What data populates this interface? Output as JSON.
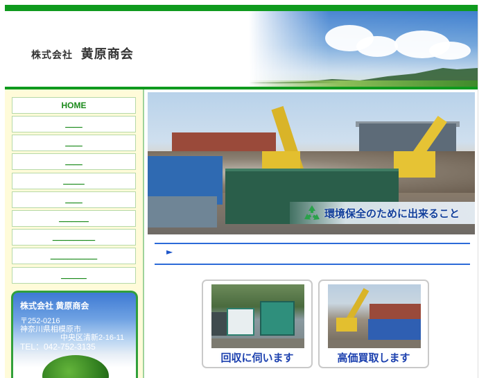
{
  "header": {
    "company_prefix": "株式会社",
    "company_name": "黄原商会"
  },
  "nav": {
    "items": [
      {
        "label": "HOME"
      },
      {
        "label": "____"
      },
      {
        "label": "____"
      },
      {
        "label": "____"
      },
      {
        "label": "_____"
      },
      {
        "label": "____"
      },
      {
        "label": "_______"
      },
      {
        "label": "__________"
      },
      {
        "label": "___________"
      },
      {
        "label": "______"
      }
    ]
  },
  "info": {
    "name": "株式会社 黄原商会",
    "postal": "〒252-0216",
    "address1": "神奈川県相模原市",
    "address2": "中央区清新2-16-11",
    "tel": "TEL：042-752-3135"
  },
  "hero": {
    "caption": "環境保全のために出来ること"
  },
  "section": {
    "arrow": "►"
  },
  "cards": {
    "collect_label": "回収に伺います",
    "buy_label": "高価買取します"
  },
  "colors": {
    "brand_green": "#0f9a1e",
    "link_blue": "#1a3fae",
    "sidebar_bg": "#fffbd9"
  }
}
